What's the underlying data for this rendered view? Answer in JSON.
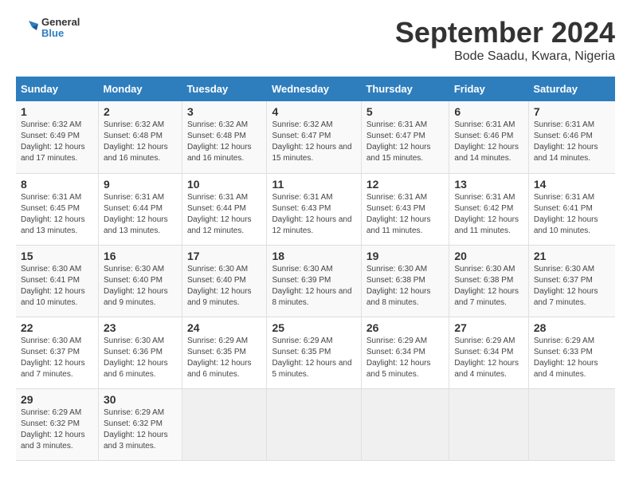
{
  "header": {
    "logo_line1": "General",
    "logo_line2": "Blue",
    "month_year": "September 2024",
    "location": "Bode Saadu, Kwara, Nigeria"
  },
  "weekdays": [
    "Sunday",
    "Monday",
    "Tuesday",
    "Wednesday",
    "Thursday",
    "Friday",
    "Saturday"
  ],
  "weeks": [
    [
      {
        "day": "1",
        "sunrise": "6:32 AM",
        "sunset": "6:49 PM",
        "daylight": "12 hours and 17 minutes."
      },
      {
        "day": "2",
        "sunrise": "6:32 AM",
        "sunset": "6:48 PM",
        "daylight": "12 hours and 16 minutes."
      },
      {
        "day": "3",
        "sunrise": "6:32 AM",
        "sunset": "6:48 PM",
        "daylight": "12 hours and 16 minutes."
      },
      {
        "day": "4",
        "sunrise": "6:32 AM",
        "sunset": "6:47 PM",
        "daylight": "12 hours and 15 minutes."
      },
      {
        "day": "5",
        "sunrise": "6:31 AM",
        "sunset": "6:47 PM",
        "daylight": "12 hours and 15 minutes."
      },
      {
        "day": "6",
        "sunrise": "6:31 AM",
        "sunset": "6:46 PM",
        "daylight": "12 hours and 14 minutes."
      },
      {
        "day": "7",
        "sunrise": "6:31 AM",
        "sunset": "6:46 PM",
        "daylight": "12 hours and 14 minutes."
      }
    ],
    [
      {
        "day": "8",
        "sunrise": "6:31 AM",
        "sunset": "6:45 PM",
        "daylight": "12 hours and 13 minutes."
      },
      {
        "day": "9",
        "sunrise": "6:31 AM",
        "sunset": "6:44 PM",
        "daylight": "12 hours and 13 minutes."
      },
      {
        "day": "10",
        "sunrise": "6:31 AM",
        "sunset": "6:44 PM",
        "daylight": "12 hours and 12 minutes."
      },
      {
        "day": "11",
        "sunrise": "6:31 AM",
        "sunset": "6:43 PM",
        "daylight": "12 hours and 12 minutes."
      },
      {
        "day": "12",
        "sunrise": "6:31 AM",
        "sunset": "6:43 PM",
        "daylight": "12 hours and 11 minutes."
      },
      {
        "day": "13",
        "sunrise": "6:31 AM",
        "sunset": "6:42 PM",
        "daylight": "12 hours and 11 minutes."
      },
      {
        "day": "14",
        "sunrise": "6:31 AM",
        "sunset": "6:41 PM",
        "daylight": "12 hours and 10 minutes."
      }
    ],
    [
      {
        "day": "15",
        "sunrise": "6:30 AM",
        "sunset": "6:41 PM",
        "daylight": "12 hours and 10 minutes."
      },
      {
        "day": "16",
        "sunrise": "6:30 AM",
        "sunset": "6:40 PM",
        "daylight": "12 hours and 9 minutes."
      },
      {
        "day": "17",
        "sunrise": "6:30 AM",
        "sunset": "6:40 PM",
        "daylight": "12 hours and 9 minutes."
      },
      {
        "day": "18",
        "sunrise": "6:30 AM",
        "sunset": "6:39 PM",
        "daylight": "12 hours and 8 minutes."
      },
      {
        "day": "19",
        "sunrise": "6:30 AM",
        "sunset": "6:38 PM",
        "daylight": "12 hours and 8 minutes."
      },
      {
        "day": "20",
        "sunrise": "6:30 AM",
        "sunset": "6:38 PM",
        "daylight": "12 hours and 7 minutes."
      },
      {
        "day": "21",
        "sunrise": "6:30 AM",
        "sunset": "6:37 PM",
        "daylight": "12 hours and 7 minutes."
      }
    ],
    [
      {
        "day": "22",
        "sunrise": "6:30 AM",
        "sunset": "6:37 PM",
        "daylight": "12 hours and 7 minutes."
      },
      {
        "day": "23",
        "sunrise": "6:30 AM",
        "sunset": "6:36 PM",
        "daylight": "12 hours and 6 minutes."
      },
      {
        "day": "24",
        "sunrise": "6:29 AM",
        "sunset": "6:35 PM",
        "daylight": "12 hours and 6 minutes."
      },
      {
        "day": "25",
        "sunrise": "6:29 AM",
        "sunset": "6:35 PM",
        "daylight": "12 hours and 5 minutes."
      },
      {
        "day": "26",
        "sunrise": "6:29 AM",
        "sunset": "6:34 PM",
        "daylight": "12 hours and 5 minutes."
      },
      {
        "day": "27",
        "sunrise": "6:29 AM",
        "sunset": "6:34 PM",
        "daylight": "12 hours and 4 minutes."
      },
      {
        "day": "28",
        "sunrise": "6:29 AM",
        "sunset": "6:33 PM",
        "daylight": "12 hours and 4 minutes."
      }
    ],
    [
      {
        "day": "29",
        "sunrise": "6:29 AM",
        "sunset": "6:32 PM",
        "daylight": "12 hours and 3 minutes."
      },
      {
        "day": "30",
        "sunrise": "6:29 AM",
        "sunset": "6:32 PM",
        "daylight": "12 hours and 3 minutes."
      },
      null,
      null,
      null,
      null,
      null
    ]
  ],
  "labels": {
    "sunrise": "Sunrise: ",
    "sunset": "Sunset: ",
    "daylight": "Daylight: "
  }
}
